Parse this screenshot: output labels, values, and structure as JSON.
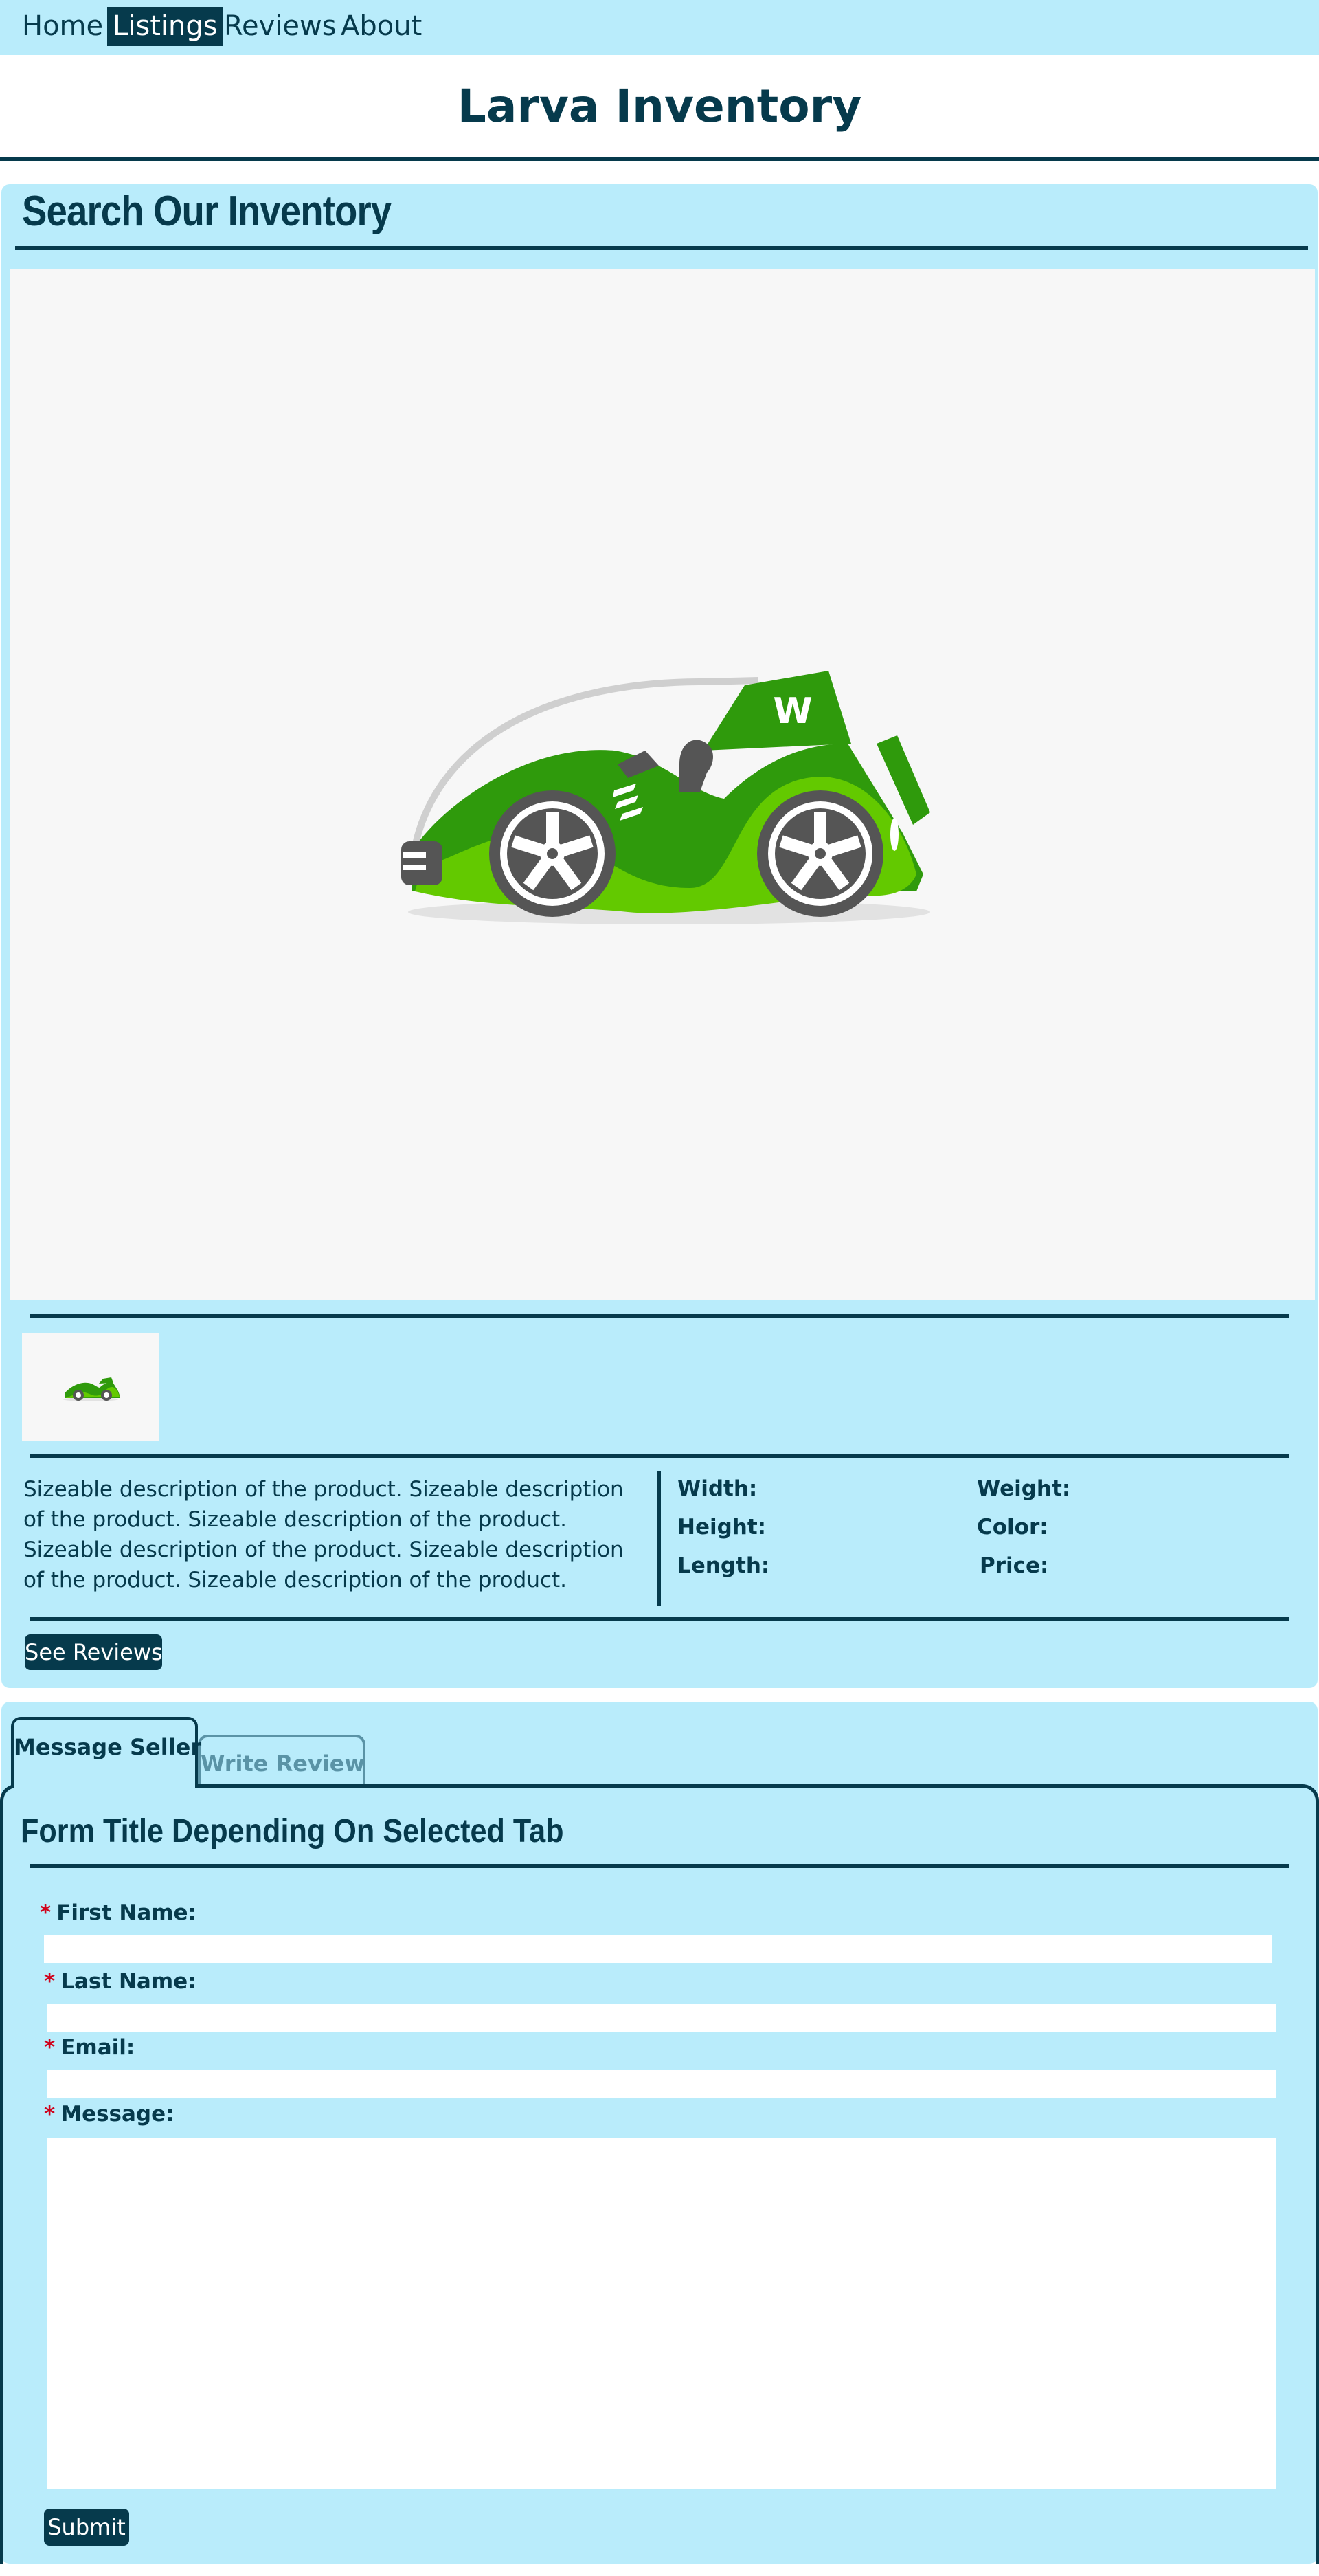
{
  "nav": {
    "items": [
      "Home",
      "Listings",
      "Reviews",
      "About"
    ],
    "active": "Listings"
  },
  "header": {
    "title": "Larva Inventory"
  },
  "inventory": {
    "title": "Search Our Inventory",
    "description": "Sizeable description of the product. Sizeable description of the product. Sizeable description of the product. Sizeable description of the product. Sizeable description of the product. Sizeable description of the product.",
    "specs": {
      "width": "Width:",
      "height": "Height:",
      "length": "Length:",
      "weight": "Weight:",
      "color": "Color:",
      "price": "Price:"
    },
    "see_reviews": "See Reviews",
    "car_badge": "W"
  },
  "form": {
    "tabs": [
      "Message Seller",
      "Write Review"
    ],
    "active_tab": "Message Seller",
    "title": "Form Title Depending On Selected Tab",
    "required_marker": "*",
    "fields": {
      "first_name": "First Name:",
      "last_name": "Last Name:",
      "email": "Email:",
      "message": "Message:"
    },
    "submit": "Submit"
  },
  "colors": {
    "primary": "#063a4c",
    "panel": "#b9ecfb",
    "required": "#d0021b",
    "car_dark_green": "#2f9a0c",
    "car_light_green": "#63c900"
  }
}
